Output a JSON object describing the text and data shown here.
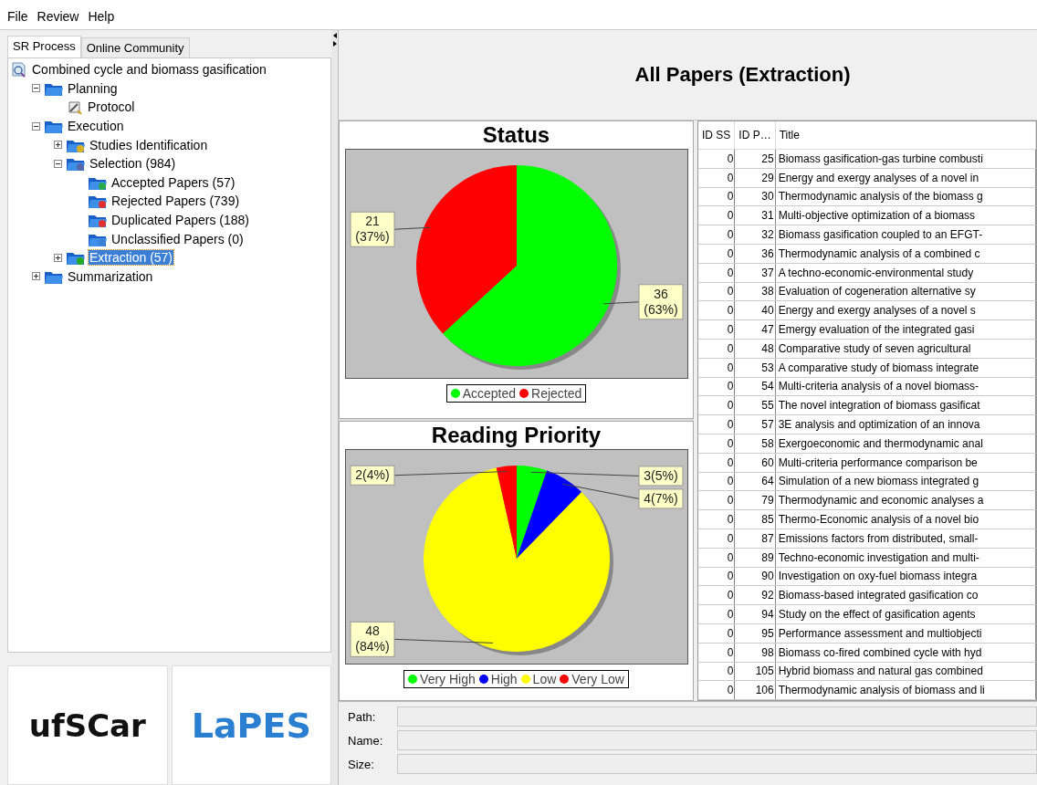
{
  "menu": [
    "File",
    "Review",
    "Help"
  ],
  "tabs": [
    {
      "label": "SR Process",
      "selected": true
    },
    {
      "label": "Online Community",
      "selected": false
    }
  ],
  "tree": [
    {
      "label": "Combined cycle and biomass gasification",
      "kind": "review",
      "selected": false,
      "children": [
        {
          "label": "Planning",
          "kind": "folder",
          "expanded": true,
          "selected": false,
          "children": [
            {
              "label": "Protocol",
              "kind": "protocol",
              "selected": false
            }
          ]
        },
        {
          "label": "Execution",
          "kind": "folder",
          "expanded": true,
          "selected": false,
          "children": [
            {
              "label": "Studies Identification",
              "kind": "edit",
              "expanded": false,
              "selected": false
            },
            {
              "label": "Selection (984)",
              "kind": "search",
              "expanded": true,
              "selected": false,
              "children": [
                {
                  "label": "Accepted Papers (57)",
                  "kind": "accepted",
                  "selected": false
                },
                {
                  "label": "Rejected Papers (739)",
                  "kind": "rejected",
                  "selected": false
                },
                {
                  "label": "Duplicated Papers (188)",
                  "kind": "duplicated",
                  "selected": false
                },
                {
                  "label": "Unclassified Papers (0)",
                  "kind": "unclassified",
                  "selected": false
                }
              ]
            },
            {
              "label": "Extraction (57)",
              "kind": "export",
              "expanded": false,
              "selected": true
            }
          ]
        },
        {
          "label": "Summarization",
          "kind": "folder",
          "expanded": false,
          "selected": false
        }
      ]
    }
  ],
  "logos": [
    "ufSCar",
    "LaPES"
  ],
  "header": {
    "title": "All Papers (Extraction)"
  },
  "charts": [
    {
      "chart_data": {
        "type": "pie",
        "title": "Status",
        "categories": [
          "Accepted",
          "Rejected"
        ],
        "values": [
          36,
          21
        ],
        "colors": [
          "#00ff00",
          "#ff0000"
        ],
        "value_labels": [
          "36\n(63%)",
          "21\n(37%)"
        ]
      }
    },
    {
      "chart_data": {
        "type": "pie",
        "title": "Reading Priority",
        "categories": [
          "Very High",
          "High",
          "Low",
          "Very Low"
        ],
        "values": [
          3,
          4,
          48,
          2
        ],
        "colors": [
          "#00ff00",
          "#0000ff",
          "#ffff00",
          "#ff0000"
        ],
        "value_labels": [
          "3(5%)",
          "4(7%)",
          "48\n(84%)",
          "2(4%)"
        ]
      }
    }
  ],
  "table": {
    "columns": [
      "ID SS",
      "ID P…",
      "Title"
    ],
    "rows": [
      [
        "0",
        "25",
        "Biomass gasification-gas turbine combusti"
      ],
      [
        "0",
        "29",
        "Energy and exergy analyses of a novel in"
      ],
      [
        "0",
        "30",
        "Thermodynamic analysis of the biomass g"
      ],
      [
        "0",
        "31",
        "Multi-objective optimization of a biomass"
      ],
      [
        "0",
        "32",
        "Biomass gasification coupled to an EFGT-"
      ],
      [
        "0",
        "36",
        "Thermodynamic analysis of a combined c"
      ],
      [
        "0",
        "37",
        "A techno-economic-environmental study"
      ],
      [
        "0",
        "38",
        "Evaluation of cogeneration alternative sy"
      ],
      [
        "0",
        "40",
        "Energy and exergy analyses of a novel s"
      ],
      [
        "0",
        "47",
        "Emergy evaluation of the integrated gasi"
      ],
      [
        "0",
        "48",
        "Comparative study of seven agricultural"
      ],
      [
        "0",
        "53",
        "A comparative study of biomass integrate"
      ],
      [
        "0",
        "54",
        "Multi-criteria analysis of a novel biomass-"
      ],
      [
        "0",
        "55",
        "The novel integration of biomass gasificat"
      ],
      [
        "0",
        "57",
        "3E analysis and optimization of an innova"
      ],
      [
        "0",
        "58",
        "Exergoeconomic and thermodynamic anal"
      ],
      [
        "0",
        "60",
        "Multi-criteria performance comparison be"
      ],
      [
        "0",
        "64",
        "Simulation of a new biomass integrated g"
      ],
      [
        "0",
        "79",
        "Thermodynamic and economic analyses a"
      ],
      [
        "0",
        "85",
        "Thermo-Economic analysis of a novel bio"
      ],
      [
        "0",
        "87",
        "Emissions factors from distributed, small-"
      ],
      [
        "0",
        "89",
        "Techno-economic investigation and multi-"
      ],
      [
        "0",
        "90",
        "Investigation on oxy-fuel biomass integra"
      ],
      [
        "0",
        "92",
        "Biomass-based integrated gasification co"
      ],
      [
        "0",
        "94",
        "Study on the effect of gasification agents"
      ],
      [
        "0",
        "95",
        "Performance assessment and multiobjecti"
      ],
      [
        "0",
        "98",
        "Biomass co-fired combined cycle with hyd"
      ],
      [
        "0",
        "105",
        "Hybrid biomass and natural gas combined"
      ],
      [
        "0",
        "106",
        "Thermodynamic analysis of biomass and li"
      ]
    ]
  },
  "form": [
    {
      "label": "Path:"
    },
    {
      "label": "Name:"
    },
    {
      "label": "Size:"
    }
  ]
}
